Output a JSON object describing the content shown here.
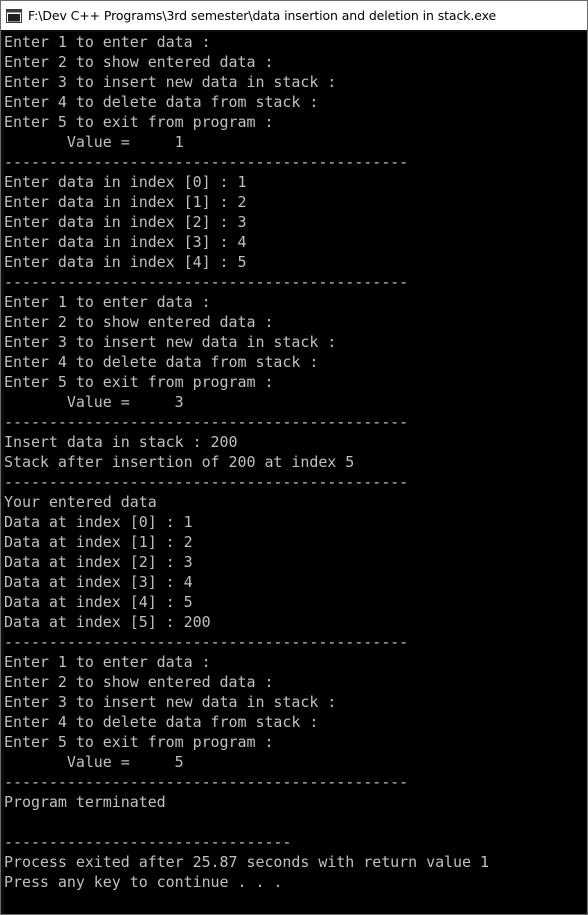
{
  "window": {
    "title": "F:\\Dev C++ Programs\\3rd semester\\data insertion and deletion in stack.exe",
    "title_icon": "console-app-icon"
  },
  "colors": {
    "console_bg": "#000000",
    "console_text": "#c0c0c0",
    "titlebar_bg": "#ffffff"
  },
  "console": {
    "lines": [
      "Enter 1 to enter data :",
      "Enter 2 to show entered data :",
      "Enter 3 to insert new data in stack :",
      "Enter 4 to delete data from stack :",
      "Enter 5 to exit from program :",
      "       Value =     1",
      "---------------------------------------------",
      "Enter data in index [0] : 1",
      "Enter data in index [1] : 2",
      "Enter data in index [2] : 3",
      "Enter data in index [3] : 4",
      "Enter data in index [4] : 5",
      "---------------------------------------------",
      "Enter 1 to enter data :",
      "Enter 2 to show entered data :",
      "Enter 3 to insert new data in stack :",
      "Enter 4 to delete data from stack :",
      "Enter 5 to exit from program :",
      "       Value =     3",
      "---------------------------------------------",
      "Insert data in stack : 200",
      "Stack after insertion of 200 at index 5",
      "---------------------------------------------",
      "Your entered data",
      "Data at index [0] : 1",
      "Data at index [1] : 2",
      "Data at index [2] : 3",
      "Data at index [3] : 4",
      "Data at index [4] : 5",
      "Data at index [5] : 200",
      "---------------------------------------------",
      "Enter 1 to enter data :",
      "Enter 2 to show entered data :",
      "Enter 3 to insert new data in stack :",
      "Enter 4 to delete data from stack :",
      "Enter 5 to exit from program :",
      "       Value =     5",
      "---------------------------------------------",
      "Program terminated",
      "",
      "--------------------------------",
      "Process exited after 25.87 seconds with return value 1",
      "Press any key to continue . . ."
    ]
  }
}
